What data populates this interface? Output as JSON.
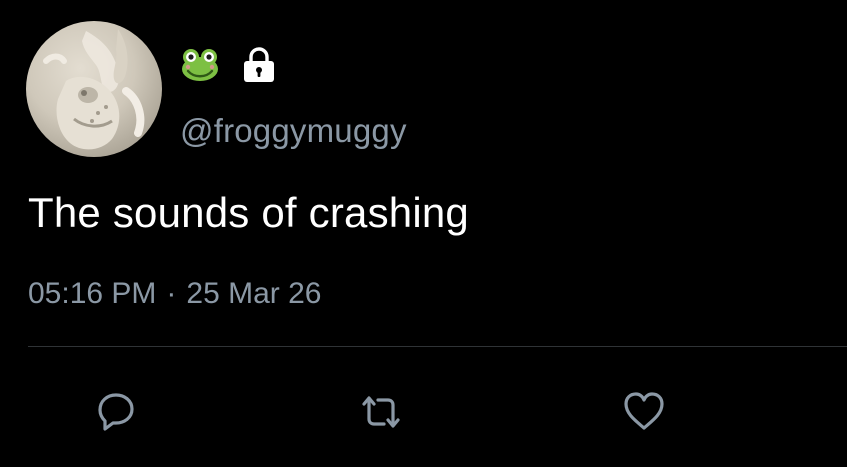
{
  "tweet": {
    "author": {
      "name_icons": [
        "frog-icon",
        "lock-icon"
      ],
      "handle": "@froggymuggy",
      "avatar": "frog-statue-avatar"
    },
    "text": "The sounds of crashing",
    "time": "05:16 PM",
    "separator": "·",
    "date": "25 Mar 26"
  },
  "actions": [
    {
      "icon": "reply-icon"
    },
    {
      "icon": "retweet-icon"
    },
    {
      "icon": "heart-icon"
    }
  ],
  "colors": {
    "background": "#000000",
    "text": "#ffffff",
    "secondary": "#8b98a5",
    "divider": "#2f3336",
    "frog_green": "#7dc043"
  }
}
